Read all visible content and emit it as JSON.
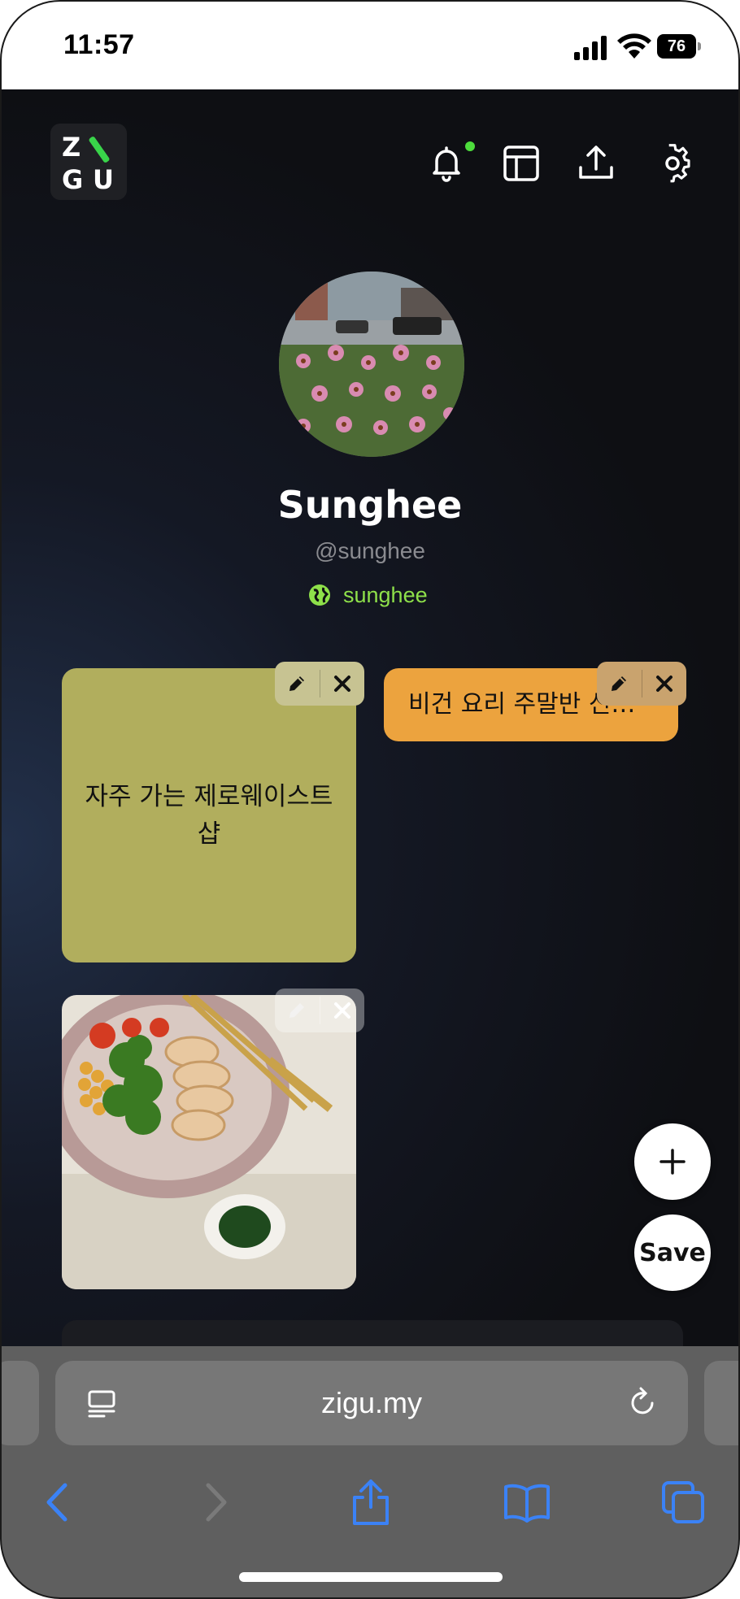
{
  "status_bar": {
    "time": "11:57",
    "battery": "76"
  },
  "app": {
    "logo": {
      "letters": [
        "Z",
        "G",
        "U"
      ]
    },
    "header_icons": [
      "bell-icon",
      "layout-icon",
      "share-upload-icon",
      "gear-icon"
    ],
    "profile": {
      "name": "Sunghee",
      "handle": "@sunghee",
      "link_label": "sunghee"
    },
    "cards": [
      {
        "type": "note",
        "text": "자주 가는 제로웨이스트 샵",
        "color": "#b1ae5d"
      },
      {
        "type": "link",
        "text": "비건 요리 주말반 신…",
        "color": "#eca33e"
      },
      {
        "type": "image",
        "description_icon": "food-photo"
      }
    ],
    "add_label": "+",
    "save_label": "Save",
    "accent_color": "#8ee04a"
  },
  "browser": {
    "url": "zigu.my"
  }
}
